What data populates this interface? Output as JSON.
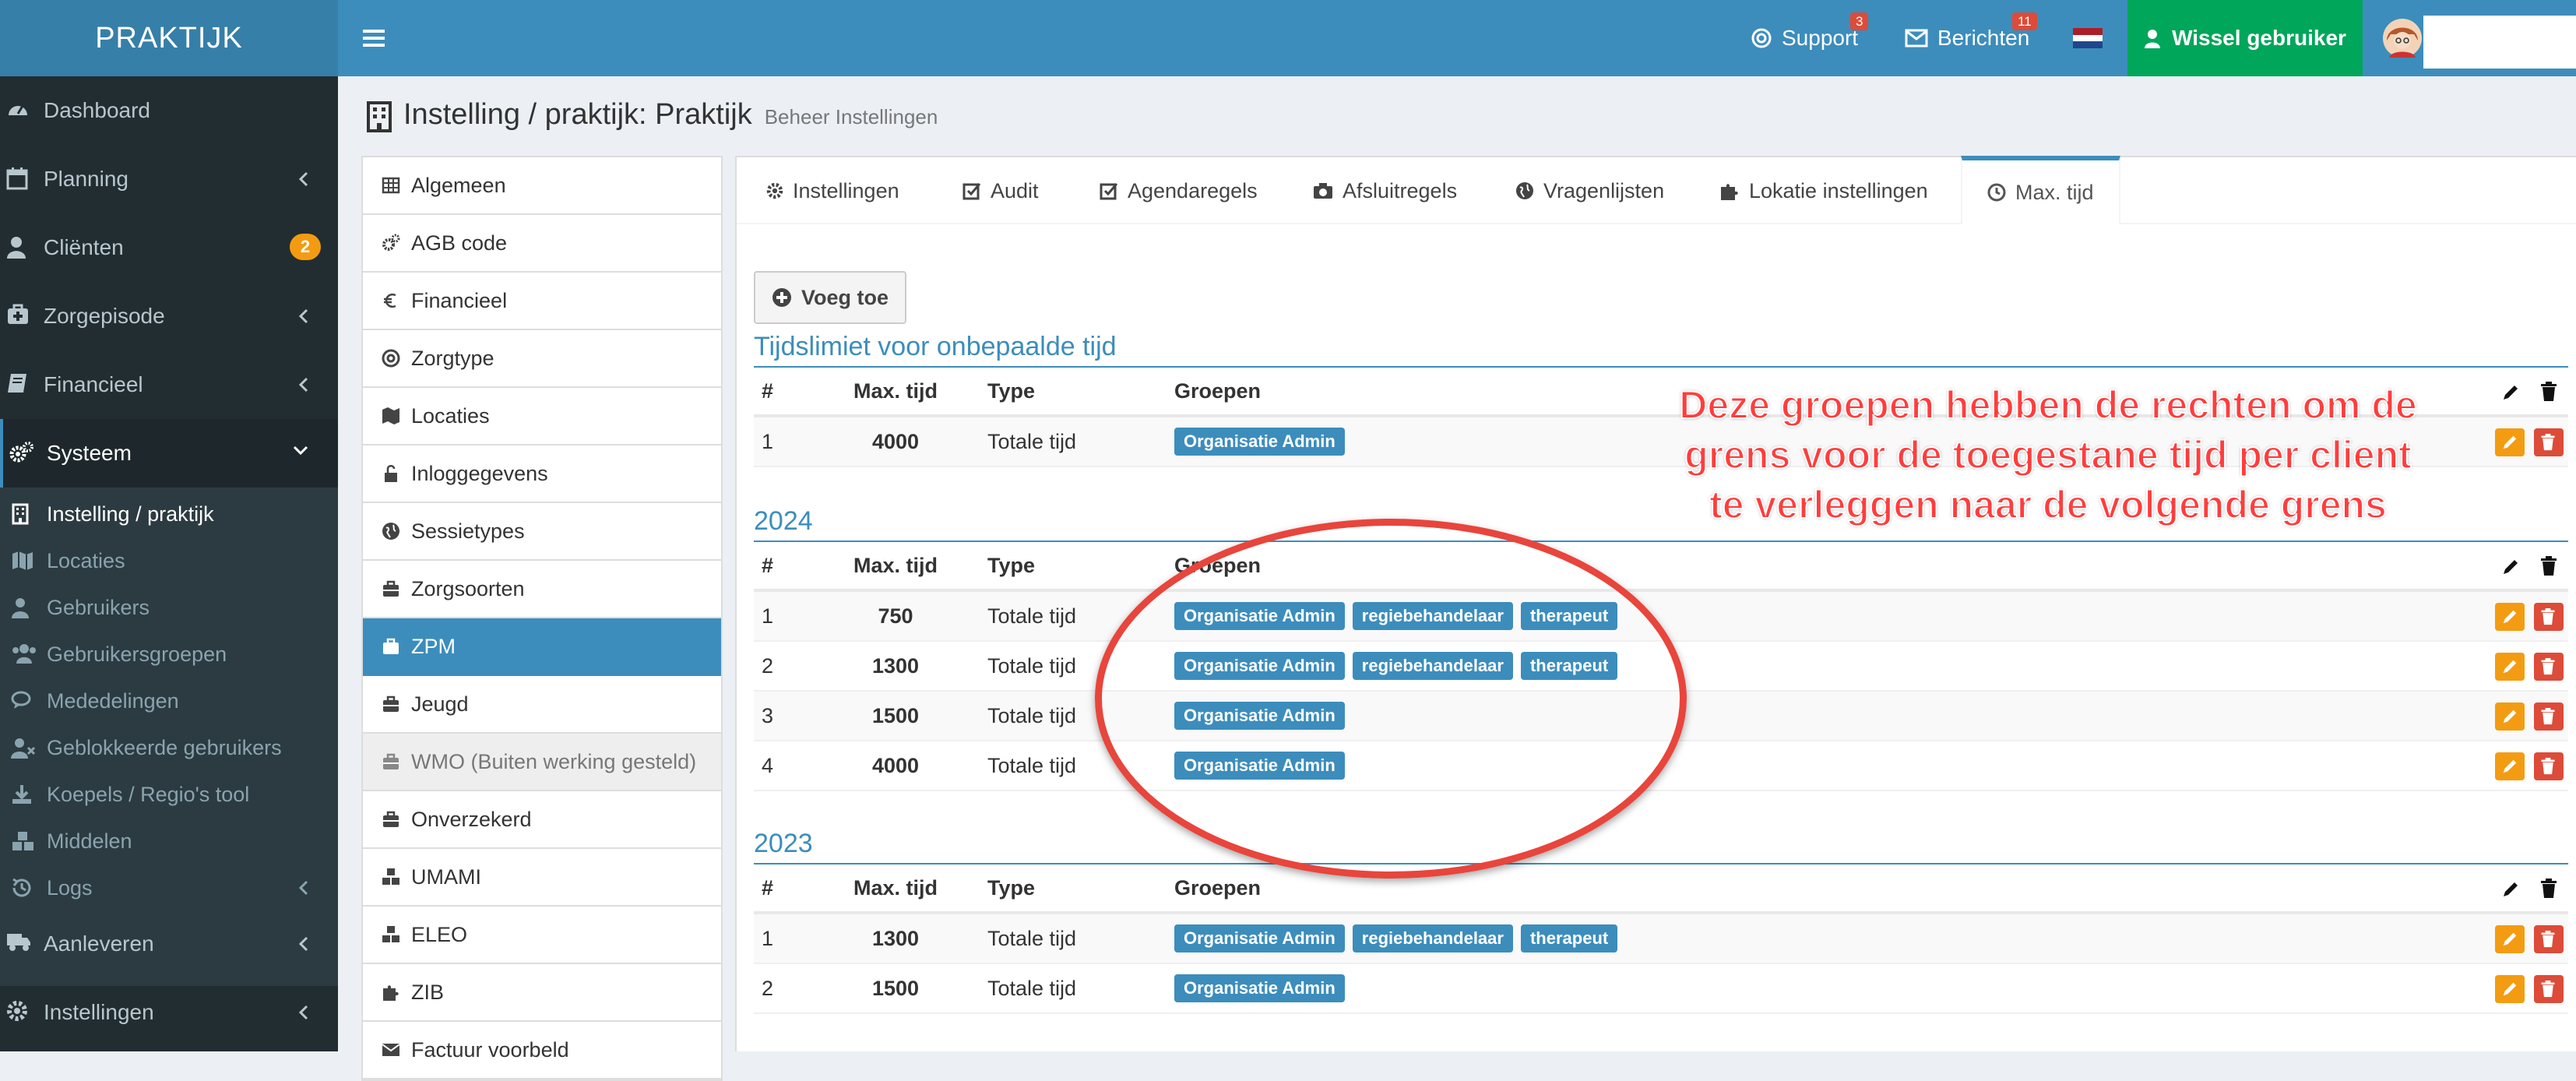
{
  "app": {
    "logo": "PRAKTIJK"
  },
  "topnav": {
    "support_label": "Support",
    "support_count": "3",
    "messages_label": "Berichten",
    "messages_count": "11",
    "switch_user_label": "Wissel gebruiker"
  },
  "sidebar": {
    "items": [
      {
        "label": "Dashboard",
        "icon": "dashboard-icon"
      },
      {
        "label": "Planning",
        "icon": "calendar-icon"
      },
      {
        "label": "Cliënten",
        "icon": "user-icon",
        "badge": "2"
      },
      {
        "label": "Zorgepisode",
        "icon": "medkit-icon"
      },
      {
        "label": "Financieel",
        "icon": "book-icon"
      },
      {
        "label": "Systeem",
        "icon": "cogs-icon"
      }
    ],
    "sub_items": [
      {
        "label": "Instelling / praktijk",
        "icon": "building-icon"
      },
      {
        "label": "Locaties",
        "icon": "map-icon"
      },
      {
        "label": "Gebruikers",
        "icon": "user-icon"
      },
      {
        "label": "Gebruikersgroepen",
        "icon": "users-icon"
      },
      {
        "label": "Mededelingen",
        "icon": "comments-icon"
      },
      {
        "label": "Geblokkeerde gebruikers",
        "icon": "user-blocked-icon"
      },
      {
        "label": "Koepels / Regio's tool",
        "icon": "download-icon"
      },
      {
        "label": "Middelen",
        "icon": "cubes-icon"
      },
      {
        "label": "Logs",
        "icon": "history-icon"
      }
    ],
    "bottom_items": [
      {
        "label": "Aanleveren",
        "icon": "truck-icon"
      },
      {
        "label": "Instellingen",
        "icon": "cog-icon"
      }
    ]
  },
  "page": {
    "title": "Instelling / praktijk: Praktijk",
    "subtitle": "Beheer Instellingen"
  },
  "leftmenu": [
    {
      "label": "Algemeen",
      "icon": "table-icon"
    },
    {
      "label": "AGB code",
      "icon": "cogs-icon"
    },
    {
      "label": "Financieel",
      "icon": "euro-icon"
    },
    {
      "label": "Zorgtype",
      "icon": "life-ring-icon"
    },
    {
      "label": "Locaties",
      "icon": "map-icon"
    },
    {
      "label": "Inloggegevens",
      "icon": "unlock-icon"
    },
    {
      "label": "Sessietypes",
      "icon": "globe-icon"
    },
    {
      "label": "Zorgsoorten",
      "icon": "briefcase-icon"
    },
    {
      "label": "ZPM",
      "icon": "briefcase-icon",
      "active": true
    },
    {
      "label": "Jeugd",
      "icon": "briefcase-icon"
    },
    {
      "label": "WMO (Buiten werking gesteld)",
      "icon": "briefcase-icon",
      "disabled": true
    },
    {
      "label": "Onverzekerd",
      "icon": "briefcase-icon"
    },
    {
      "label": "UMAMI",
      "icon": "cubes-icon"
    },
    {
      "label": "ELEO",
      "icon": "cubes-icon"
    },
    {
      "label": "ZIB",
      "icon": "puzzle-icon"
    },
    {
      "label": "Factuur voorbeld",
      "icon": "envelope-icon"
    }
  ],
  "tabs": [
    {
      "label": "Instellingen",
      "icon": "cog-icon"
    },
    {
      "label": "Audit",
      "icon": "check-square-icon"
    },
    {
      "label": "Agendaregels",
      "icon": "check-square-icon"
    },
    {
      "label": "Afsluitregels",
      "icon": "camera-icon"
    },
    {
      "label": "Vragenlijsten",
      "icon": "globe-icon"
    },
    {
      "label": "Lokatie instellingen",
      "icon": "puzzle-icon"
    },
    {
      "label": "Max. tijd",
      "icon": "clock-icon",
      "active": true
    }
  ],
  "add_button": "Voeg toe",
  "table_headers": {
    "num": "#",
    "max": "Max. tijd",
    "type": "Type",
    "groups": "Groepen"
  },
  "sections": [
    {
      "heading": "Tijdslimiet voor onbepaalde tijd",
      "rows": [
        {
          "num": "1",
          "max": "4000",
          "type": "Totale tijd",
          "groups": [
            "Organisatie Admin"
          ]
        }
      ]
    },
    {
      "heading": "2024",
      "rows": [
        {
          "num": "1",
          "max": "750",
          "type": "Totale tijd",
          "groups": [
            "Organisatie Admin",
            "regiebehandelaar",
            "therapeut"
          ]
        },
        {
          "num": "2",
          "max": "1300",
          "type": "Totale tijd",
          "groups": [
            "Organisatie Admin",
            "regiebehandelaar",
            "therapeut"
          ]
        },
        {
          "num": "3",
          "max": "1500",
          "type": "Totale tijd",
          "groups": [
            "Organisatie Admin"
          ]
        },
        {
          "num": "4",
          "max": "4000",
          "type": "Totale tijd",
          "groups": [
            "Organisatie Admin"
          ]
        }
      ]
    },
    {
      "heading": "2023",
      "rows": [
        {
          "num": "1",
          "max": "1300",
          "type": "Totale tijd",
          "groups": [
            "Organisatie Admin",
            "regiebehandelaar",
            "therapeut"
          ]
        },
        {
          "num": "2",
          "max": "1500",
          "type": "Totale tijd",
          "groups": [
            "Organisatie Admin"
          ]
        }
      ]
    }
  ],
  "annotation": {
    "line1": "Deze groepen hebben de rechten om de",
    "line2": "grens voor de toegestane tijd per client",
    "line3": "te verleggen naar de volgende grens"
  },
  "colors": {
    "primary": "#3c8dbc",
    "success": "#00a65a",
    "warning": "#f39c12",
    "danger": "#dd4b39",
    "sidebar": "#222d32",
    "annotation": "#ff3d3d"
  }
}
